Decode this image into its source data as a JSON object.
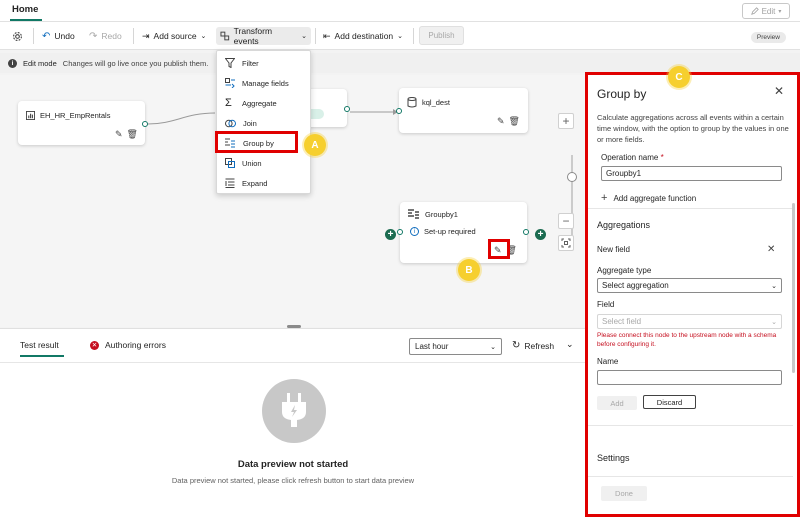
{
  "tabs": {
    "home": "Home",
    "edit_label": "Edit"
  },
  "toolbar": {
    "undo": "Undo",
    "redo": "Redo",
    "add_source": "Add source",
    "transform_events": "Transform events",
    "add_destination": "Add destination",
    "publish": "Publish",
    "preview_badge": "Preview"
  },
  "edit_mode": {
    "title": "Edit mode",
    "message": "Changes will go live once you publish them."
  },
  "transform_menu": {
    "items": [
      {
        "label": "Filter",
        "icon": "filter-icon"
      },
      {
        "label": "Manage fields",
        "icon": "manage-fields-icon"
      },
      {
        "label": "Aggregate",
        "icon": "sigma-icon"
      },
      {
        "label": "Join",
        "icon": "join-icon"
      },
      {
        "label": "Group by",
        "icon": "group-by-icon"
      },
      {
        "label": "Union",
        "icon": "union-icon"
      },
      {
        "label": "Expand",
        "icon": "expand-icon"
      }
    ]
  },
  "canvas": {
    "source_node": {
      "label": "EH_HR_EmpRentals"
    },
    "dest_node": {
      "label": "kql_dest"
    },
    "groupby_node": {
      "label": "Groupby1",
      "status": "Set-up required"
    }
  },
  "callouts": {
    "a": "A",
    "b": "B",
    "c": "C"
  },
  "colors": {
    "accent": "#117865",
    "highlight": "#e00000",
    "callout": "#f6cf2e",
    "error": "#c50f1f"
  },
  "bottom_panel": {
    "tab_test_result": "Test result",
    "tab_authoring_errors": "Authoring errors",
    "time_range": "Last hour",
    "refresh": "Refresh",
    "empty_title": "Data preview not started",
    "empty_message": "Data preview not started, please click refresh button to start data preview"
  },
  "group_by_panel": {
    "title": "Group by",
    "description": "Calculate aggregations across all events within a certain time window, with the option to group by the values in one or more fields.",
    "operation_name_label": "Operation name",
    "operation_name_required": "*",
    "operation_name_value": "Groupby1",
    "add_aggregate_function": "Add aggregate function",
    "aggregations_heading": "Aggregations",
    "new_field_heading": "New field",
    "aggregate_type_label": "Aggregate type",
    "aggregate_type_placeholder": "Select aggregation",
    "field_label": "Field",
    "field_placeholder": "Select field",
    "field_error": "Please connect this node to the upstream node with a schema before configuring it.",
    "name_label": "Name",
    "name_value": "",
    "add_button": "Add",
    "discard_button": "Discard",
    "settings_heading": "Settings",
    "done_button": "Done"
  }
}
